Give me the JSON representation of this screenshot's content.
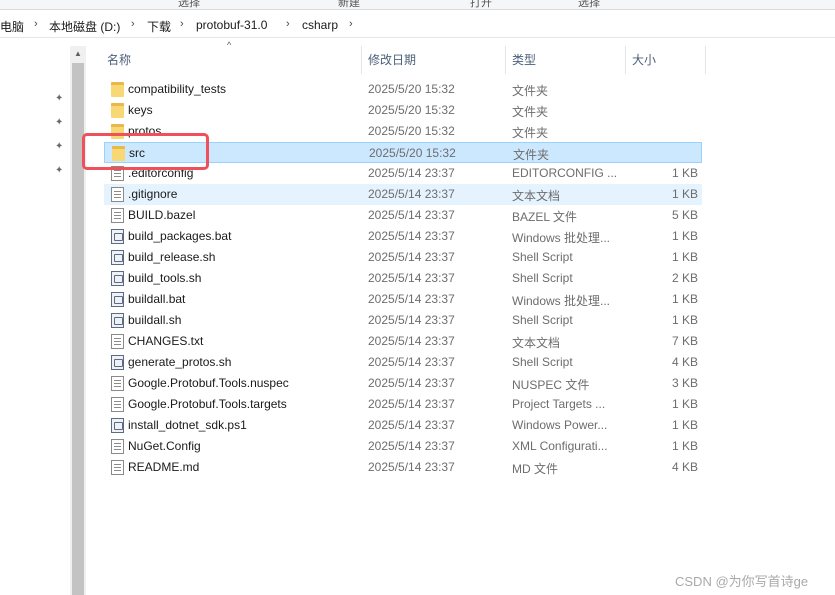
{
  "ribbon": {
    "items": [
      "选择",
      "新建",
      "打开",
      "选择"
    ]
  },
  "breadcrumb": {
    "items": [
      "电脑",
      "本地磁盘 (D:)",
      "下载",
      "protobuf-31.0",
      "csharp"
    ]
  },
  "columns": {
    "name": "名称",
    "date": "修改日期",
    "type": "类型",
    "size": "大小"
  },
  "files": [
    {
      "name": "compatibility_tests",
      "date": "2025/5/20 15:32",
      "type": "文件夹",
      "size": "",
      "icon": "folder-icon"
    },
    {
      "name": "keys",
      "date": "2025/5/20 15:32",
      "type": "文件夹",
      "size": "",
      "icon": "folder-icon"
    },
    {
      "name": "protos",
      "date": "2025/5/20 15:32",
      "type": "文件夹",
      "size": "",
      "icon": "folder-icon"
    },
    {
      "name": "src",
      "date": "2025/5/20 15:32",
      "type": "文件夹",
      "size": "",
      "icon": "folder-icon"
    },
    {
      "name": ".editorconfig",
      "date": "2025/5/14 23:37",
      "type": "EDITORCONFIG ...",
      "size": "1 KB",
      "icon": "file-icon"
    },
    {
      "name": ".gitignore",
      "date": "2025/5/14 23:37",
      "type": "文本文档",
      "size": "1 KB",
      "icon": "file-icon"
    },
    {
      "name": "BUILD.bazel",
      "date": "2025/5/14 23:37",
      "type": "BAZEL 文件",
      "size": "5 KB",
      "icon": "file-icon"
    },
    {
      "name": "build_packages.bat",
      "date": "2025/5/14 23:37",
      "type": "Windows 批处理...",
      "size": "1 KB",
      "icon": "script-icon"
    },
    {
      "name": "build_release.sh",
      "date": "2025/5/14 23:37",
      "type": "Shell Script",
      "size": "1 KB",
      "icon": "script-icon"
    },
    {
      "name": "build_tools.sh",
      "date": "2025/5/14 23:37",
      "type": "Shell Script",
      "size": "2 KB",
      "icon": "script-icon"
    },
    {
      "name": "buildall.bat",
      "date": "2025/5/14 23:37",
      "type": "Windows 批处理...",
      "size": "1 KB",
      "icon": "script-icon"
    },
    {
      "name": "buildall.sh",
      "date": "2025/5/14 23:37",
      "type": "Shell Script",
      "size": "1 KB",
      "icon": "script-icon"
    },
    {
      "name": "CHANGES.txt",
      "date": "2025/5/14 23:37",
      "type": "文本文档",
      "size": "7 KB",
      "icon": "file-icon"
    },
    {
      "name": "generate_protos.sh",
      "date": "2025/5/14 23:37",
      "type": "Shell Script",
      "size": "4 KB",
      "icon": "script-icon"
    },
    {
      "name": "Google.Protobuf.Tools.nuspec",
      "date": "2025/5/14 23:37",
      "type": "NUSPEC 文件",
      "size": "3 KB",
      "icon": "file-icon"
    },
    {
      "name": "Google.Protobuf.Tools.targets",
      "date": "2025/5/14 23:37",
      "type": "Project Targets ...",
      "size": "1 KB",
      "icon": "file-icon"
    },
    {
      "name": "install_dotnet_sdk.ps1",
      "date": "2025/5/14 23:37",
      "type": "Windows Power...",
      "size": "1 KB",
      "icon": "script-icon"
    },
    {
      "name": "NuGet.Config",
      "date": "2025/5/14 23:37",
      "type": "XML Configurati...",
      "size": "1 KB",
      "icon": "file-icon"
    },
    {
      "name": "README.md",
      "date": "2025/5/14 23:37",
      "type": "MD 文件",
      "size": "4 KB",
      "icon": "file-icon"
    }
  ],
  "selected_index": 3,
  "hover_index": 5,
  "watermark": "CSDN @为你写首诗ge",
  "colors": {
    "selection": "#cce8ff",
    "highlight_box": "#f0505a",
    "folder": "#f8d775"
  }
}
